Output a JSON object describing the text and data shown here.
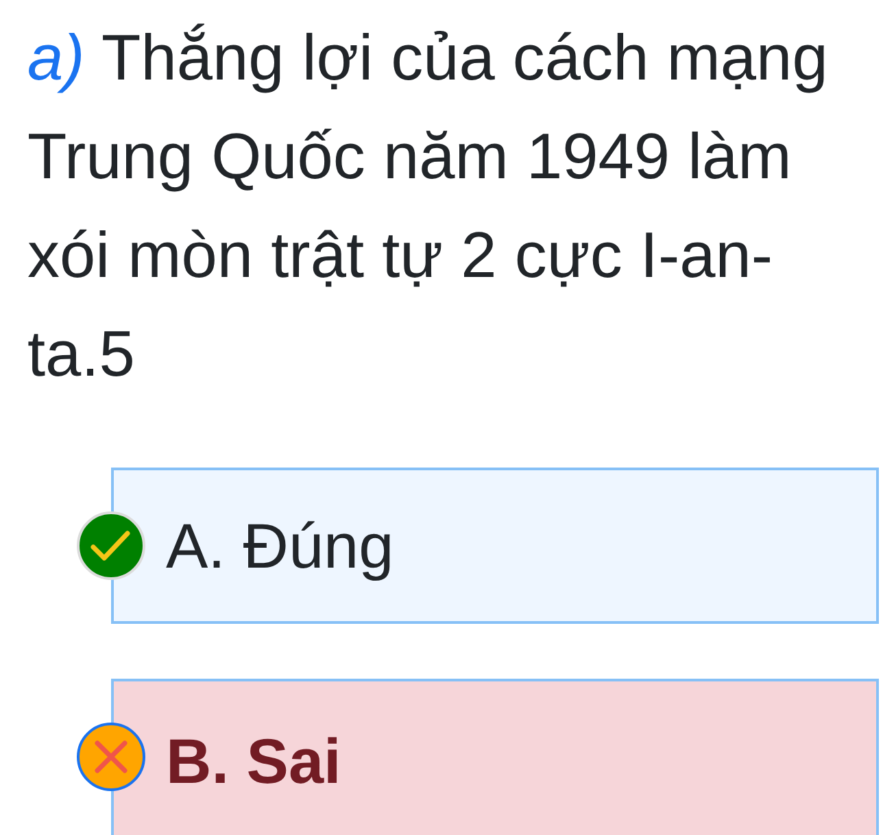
{
  "question": {
    "text": "*a)* Thắng lợi của cách mạng Trung Quốc năm 1949 làm xói mòn trật tự 2 cực I-an-ta.5"
  },
  "options": [
    {
      "kind": "check",
      "label": "A. Đúng",
      "selected": false
    },
    {
      "kind": "cross",
      "label": "B. Sai",
      "selected": true
    }
  ]
}
